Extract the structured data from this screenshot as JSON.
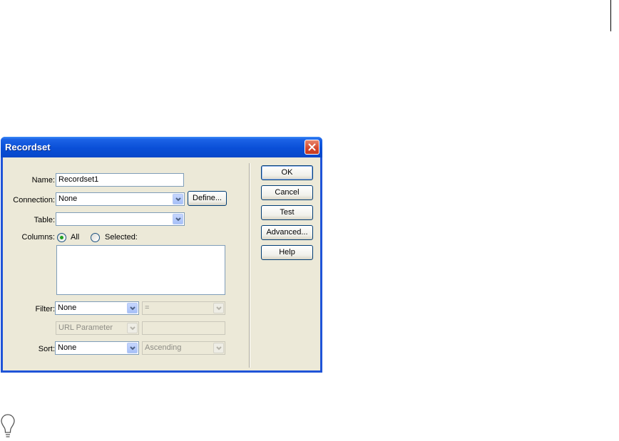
{
  "dialog": {
    "title": "Recordset"
  },
  "fields": {
    "name": {
      "label": "Name:",
      "value": "Recordset1"
    },
    "connection": {
      "label": "Connection:",
      "value": "None",
      "define_label": "Define..."
    },
    "table": {
      "label": "Table:",
      "value": ""
    },
    "columns": {
      "label": "Columns:",
      "option_all": "All",
      "option_selected": "Selected:",
      "selected": "All"
    },
    "filter": {
      "label": "Filter:",
      "value": "None",
      "operator": "=",
      "source": "URL Parameter",
      "source_value": ""
    },
    "sort": {
      "label": "Sort:",
      "value": "None",
      "direction": "Ascending"
    }
  },
  "buttons": {
    "ok": "OK",
    "cancel": "Cancel",
    "test": "Test",
    "advanced": "Advanced...",
    "help": "Help"
  },
  "icons": {
    "close": "close-icon",
    "dropdown": "chevron-down-icon",
    "tip": "lightbulb-icon"
  },
  "colors": {
    "titlebar": "#0a4fd7",
    "dialog_bg": "#ece9d8",
    "close_button": "#d4462c",
    "radio_dot": "#21a121"
  }
}
